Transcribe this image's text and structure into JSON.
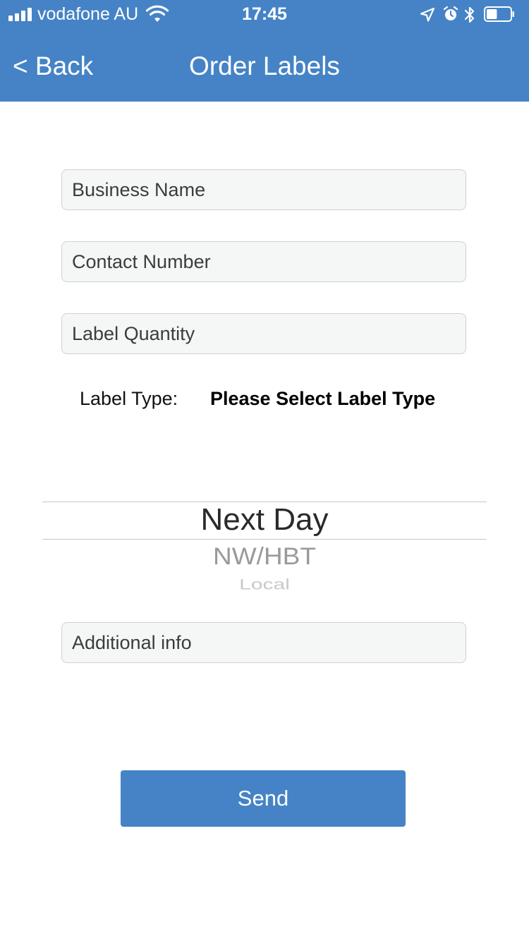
{
  "status_bar": {
    "carrier": "vodafone AU",
    "time": "17:45",
    "icons": [
      "signal-icon",
      "wifi-icon",
      "location-icon",
      "alarm-icon",
      "bluetooth-icon",
      "battery-icon"
    ],
    "battery_level": 0.45
  },
  "nav": {
    "back_label": "< Back",
    "title": "Order Labels"
  },
  "form": {
    "business_name_placeholder": "Business Name",
    "contact_number_placeholder": "Contact Number",
    "label_quantity_placeholder": "Label Quantity",
    "label_type_label": "Label Type:",
    "label_type_value": "Please Select Label Type",
    "picker_options": [
      "Next Day",
      "NW/HBT",
      "Local"
    ],
    "picker_selected": "Next Day",
    "additional_info_placeholder": "Additional info",
    "send_label": "Send"
  },
  "colors": {
    "accent": "#4583c6",
    "field_background": "#f5f6f6",
    "field_border": "#cfd1d3"
  }
}
